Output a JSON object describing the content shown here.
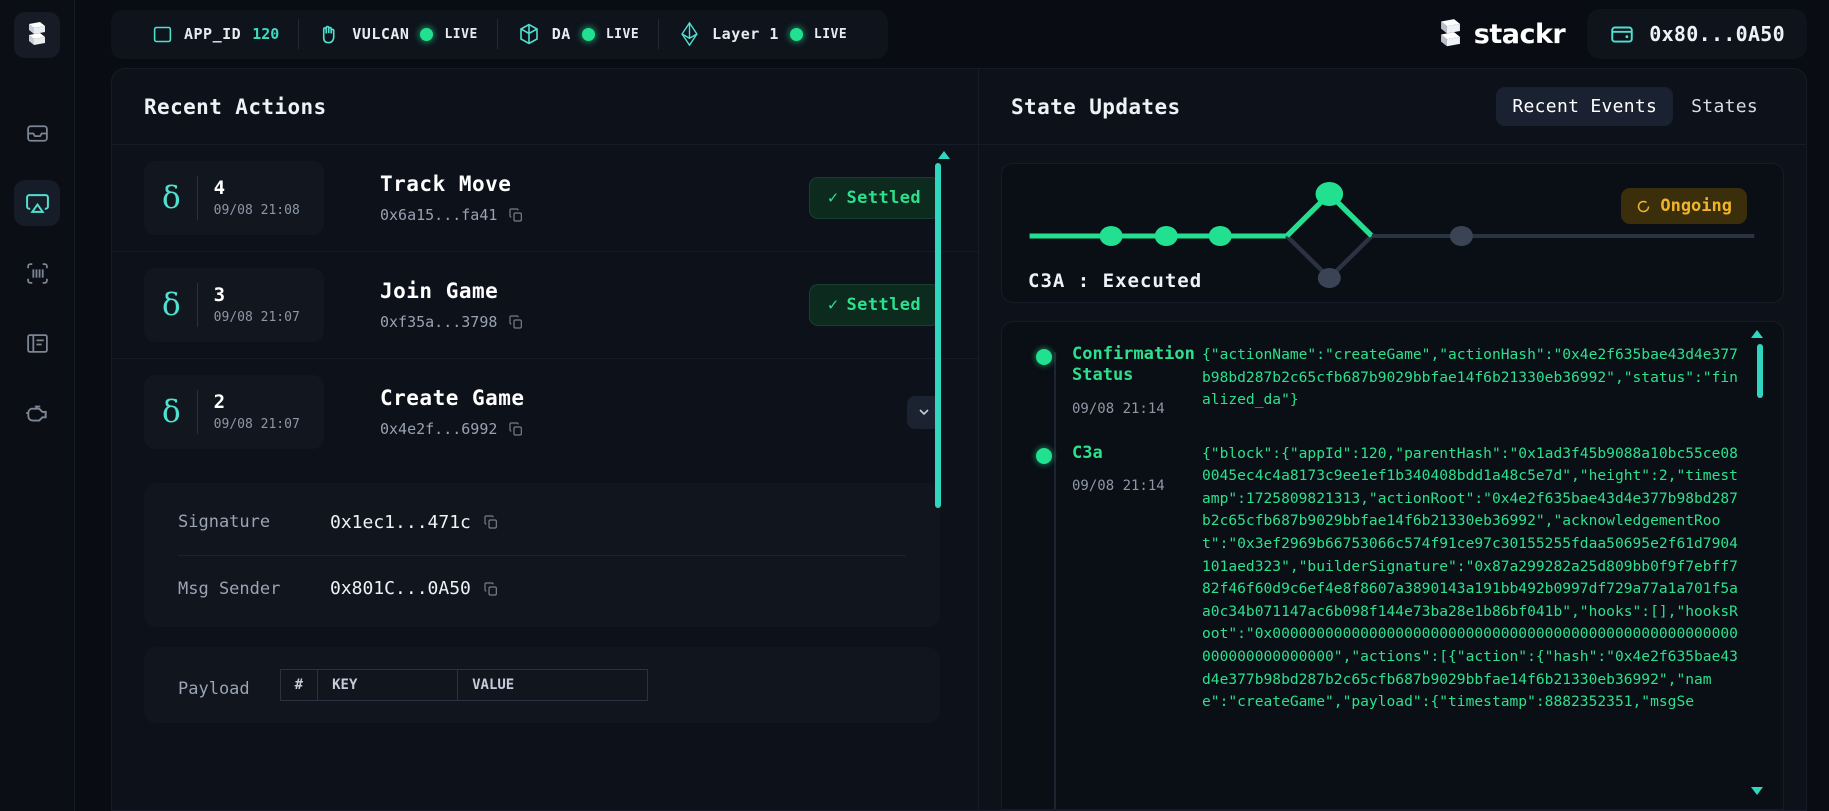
{
  "topbar": {
    "chips": [
      {
        "icon": "app-window-icon",
        "label": "APP_ID",
        "value": "120",
        "status": ""
      },
      {
        "icon": "hand-icon",
        "label": "VULCAN",
        "value": "",
        "status": "LIVE"
      },
      {
        "icon": "cube-icon",
        "label": "DA",
        "value": "",
        "status": "LIVE"
      },
      {
        "icon": "ethereum-icon",
        "label": "Layer 1",
        "value": "",
        "status": "LIVE"
      }
    ],
    "brand": "stackr",
    "wallet_address": "0x80...0A50"
  },
  "sidebar": {
    "items": [
      {
        "icon": "inbox-icon",
        "active": false
      },
      {
        "icon": "airplay-icon",
        "active": true
      },
      {
        "icon": "scan-barcode-icon",
        "active": false
      },
      {
        "icon": "book-icon",
        "active": false
      },
      {
        "icon": "engine-icon",
        "active": false
      }
    ]
  },
  "recent_actions": {
    "title": "Recent Actions",
    "rows": [
      {
        "id": "4",
        "time": "09/08 21:08",
        "name": "Track Move",
        "hash": "0x6a15...fa41",
        "status": "Settled",
        "expanded": false
      },
      {
        "id": "3",
        "time": "09/08 21:07",
        "name": "Join Game",
        "hash": "0xf35a...3798",
        "status": "Settled",
        "expanded": false
      },
      {
        "id": "2",
        "time": "09/08 21:07",
        "name": "Create Game",
        "hash": "0x4e2f...6992",
        "status": "",
        "expanded": true
      }
    ],
    "detail": {
      "signature_label": "Signature",
      "signature_value": "0x1ec1...471c",
      "msg_sender_label": "Msg Sender",
      "msg_sender_value": "0x801C...0A50",
      "payload_label": "Payload",
      "payload_headers": [
        "#",
        "KEY",
        "VALUE"
      ]
    }
  },
  "state_updates": {
    "title": "State Updates",
    "tabs": [
      {
        "label": "Recent Events",
        "active": true
      },
      {
        "label": "States",
        "active": false
      }
    ],
    "flow": {
      "label": "C3A : Executed",
      "badge": "Ongoing",
      "badge_icon": "spinner-icon",
      "completed_nodes": 4,
      "pending_nodes": 2
    },
    "events": [
      {
        "title": "Confirmation Status",
        "time": "09/08 21:14",
        "json": "{\"actionName\":\"createGame\",\"actionHash\":\"0x4e2f635bae43d4e377b98bd287b2c65cfb687b9029bbfae14f6b21330eb36992\",\"status\":\"finalized_da\"}"
      },
      {
        "title": "C3a",
        "time": "09/08 21:14",
        "json": "{\"block\":{\"appId\":120,\"parentHash\":\"0x1ad3f45b9088a10bc55ce080045ec4c4a8173c9ee1ef1b340408bdd1a48c5e7d\",\"height\":2,\"timestamp\":1725809821313,\"actionRoot\":\"0x4e2f635bae43d4e377b98bd287b2c65cfb687b9029bbfae14f6b21330eb36992\",\"acknowledgementRoot\":\"0x3ef2969b66753066c574f91ce97c30155255fdaa50695e2f61d7904101aed323\",\"builderSignature\":\"0x87a299282a25d809bb0f9f7ebff782f46f60d9c6ef4e8f8607a3890143a191bb492b0997df729a77a1a701f5aa0c34b071147ac6b098f144e73ba28e1b86bf041b\",\"hooks\":[],\"hooksRoot\":\"0x00000000000000000000000000000000000000000000000000000000000000000000\",\"actions\":[{\"action\":{\"hash\":\"0x4e2f635bae43d4e377b98bd287b2c65cfb687b9029bbfae14f6b21330eb36992\",\"name\":\"createGame\",\"payload\":{\"timestamp\":8882352351,\"msgSe"
      }
    ]
  },
  "colors": {
    "accent_green": "#21e08f",
    "accent_teal": "#3ddbc0",
    "warning_amber": "#f0b429",
    "panel_bg": "#0d1119",
    "page_bg": "#090c12"
  }
}
